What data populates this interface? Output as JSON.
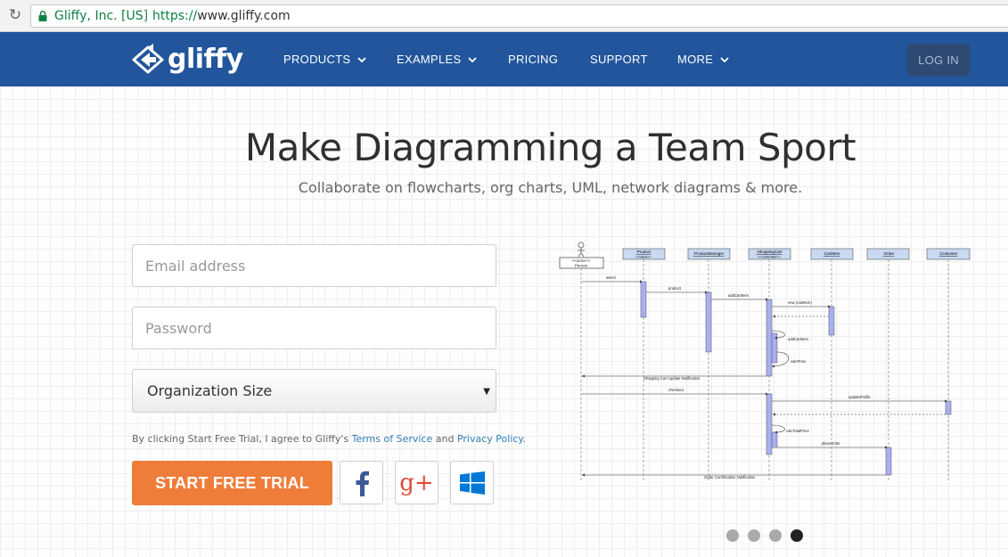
{
  "browser": {
    "site_identity": "Gliffy, Inc. [US]",
    "url_scheme": "https://",
    "url_host": "www.gliffy.com"
  },
  "nav": {
    "logo_text": "gliffy",
    "items": [
      {
        "label": "PRODUCTS",
        "has_caret": true
      },
      {
        "label": "EXAMPLES",
        "has_caret": true
      },
      {
        "label": "PRICING",
        "has_caret": false
      },
      {
        "label": "SUPPORT",
        "has_caret": false
      },
      {
        "label": "MORE",
        "has_caret": true
      }
    ],
    "login_label": "LOG IN"
  },
  "hero": {
    "title": "Make Diagramming a Team Sport",
    "subtitle": "Collaborate on flowcharts, org charts, UML, network diagrams & more."
  },
  "form": {
    "email_placeholder": "Email address",
    "password_placeholder": "Password",
    "org_size_value": "Organization Size",
    "terms_prefix": "By clicking Start Free Trial, I agree to Gliffy's ",
    "terms_link": "Terms of Service",
    "terms_and": " and ",
    "privacy_link": "Privacy Policy",
    "terms_suffix": ".",
    "cta_label": "START FREE TRIAL",
    "social": [
      {
        "name": "facebook-icon",
        "glyph": "f",
        "color": "#3b5998"
      },
      {
        "name": "google-plus-icon",
        "glyph": "g+",
        "color": "#dd4b39"
      },
      {
        "name": "windows-icon",
        "glyph": "",
        "color": "#0078d7"
      }
    ]
  },
  "diagram": {
    "actor_label": "<<actor>>",
    "actor_name": "Person",
    "lifelines": [
      {
        "name": ":Product",
        "stereotype": "<<view>>"
      },
      {
        "name": ":ProductManager",
        "stereotype": ""
      },
      {
        "name": ":ShoppingCart",
        "stereotype": "<<controller>>"
      },
      {
        "name": ":CartItem",
        "stereotype": ""
      },
      {
        "name": ":Order",
        "stereotype": ""
      },
      {
        "name": ":Customer",
        "stereotype": ""
      }
    ],
    "messages": [
      "select",
      "product",
      "addCartItem",
      "new (cartItem)",
      "addCartItem",
      "calcPrice",
      "Shopping Cart Update Notification",
      "checkout",
      "updateProfile",
      "calcTotalPrice",
      "placeOrder",
      "Order Confirmation Notification"
    ]
  },
  "carousel": {
    "count": 4,
    "active_index": 3
  },
  "colors": {
    "nav_bg": "#22559c",
    "cta": "#ee7d3a",
    "link": "#2f7fb6",
    "lifeline_box": "#c9d9f2",
    "activation": "#a8b0f0"
  }
}
